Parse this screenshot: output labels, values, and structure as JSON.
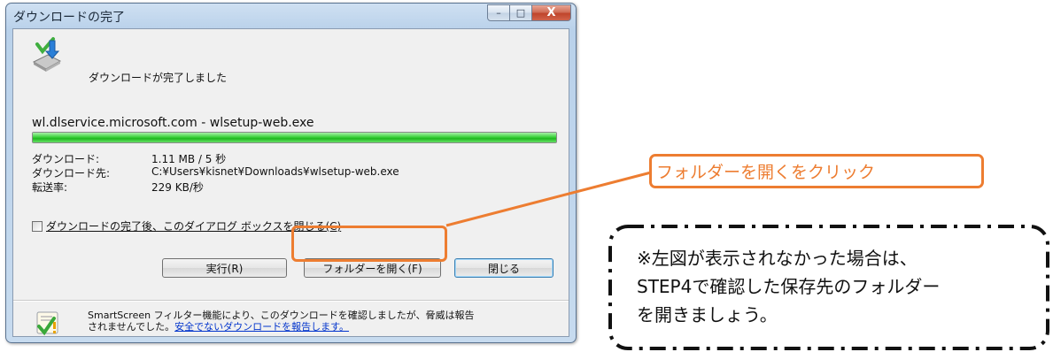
{
  "window": {
    "title": "ダウンロードの完了",
    "controls": {
      "minimize": "–",
      "maximize": "□",
      "close": "X"
    }
  },
  "download": {
    "status_message": "ダウンロードが完了しました",
    "file_name": "wl.dlservice.microsoft.com - wlsetup-web.exe",
    "progress": 1.0,
    "fields": [
      {
        "label": "ダウンロード:",
        "value": "1.11 MB / 5 秒"
      },
      {
        "label": "ダウンロード先:",
        "value": "C:¥Users¥kisnet¥Downloads¥wlsetup-web.exe"
      },
      {
        "label": "転送率:",
        "value": "229 KB/秒"
      }
    ],
    "close_on_complete_label": "ダウンロードの完了後、このダイアログ ボックスを閉じる(C)",
    "close_on_complete_checked": false
  },
  "buttons": {
    "run": "実行(R)",
    "open_folder": "フォルダーを開く(F)",
    "close": "閉じる"
  },
  "smartscreen": {
    "line1": "SmartScreen フィルター機能により、このダウンロードを確認しましたが、脅威は報告",
    "line2_text": "されませんでした。",
    "line2_link": "安全でないダウンロードを報告します。"
  },
  "annotations": {
    "callout": "フォルダーを開くをクリック",
    "note_lines": [
      "※左図が表示されなかった場合は、",
      "STEP4で確認した保存先のフォルダー",
      "を開きましょう。"
    ],
    "accent_color": "#ed7d31"
  }
}
